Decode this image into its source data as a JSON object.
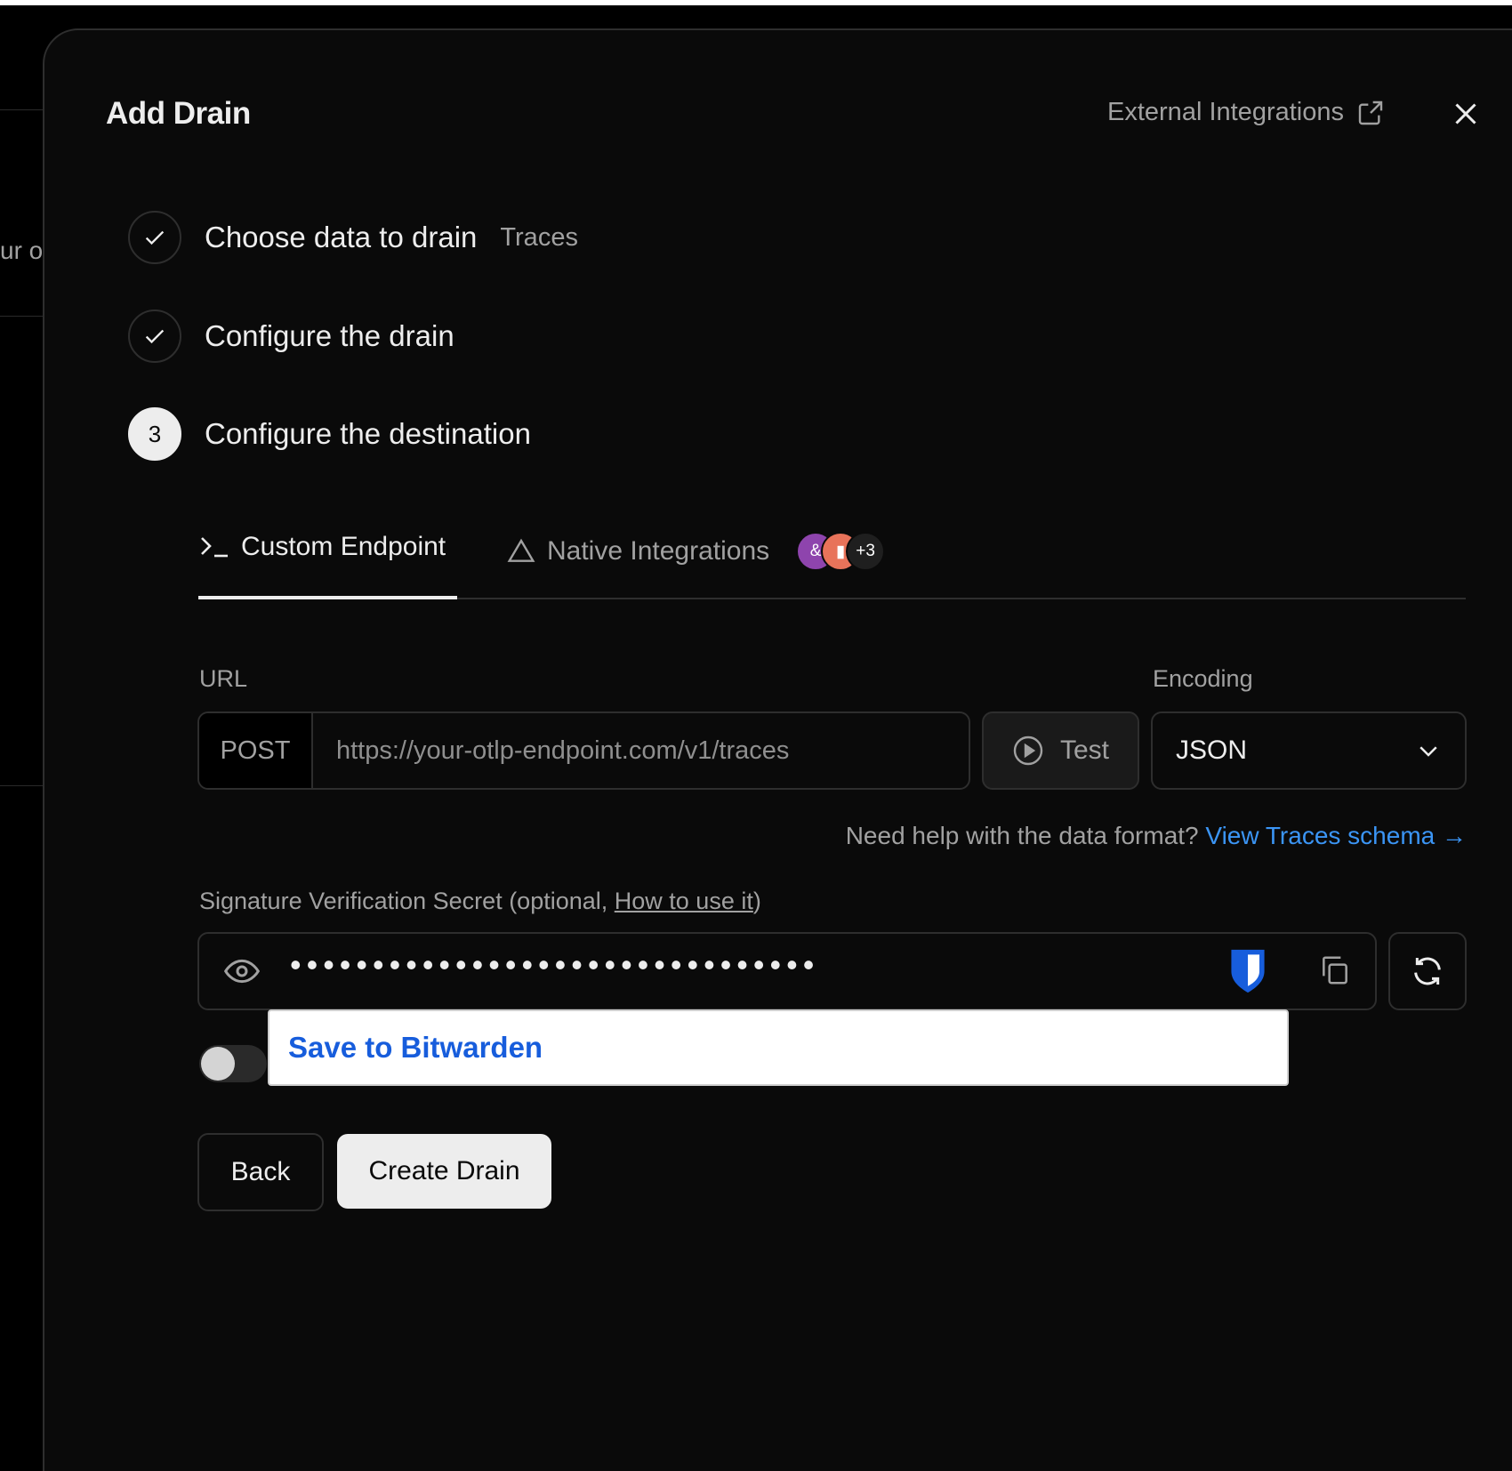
{
  "background": {
    "partial_text": "ur o"
  },
  "dialog": {
    "title": "Add Drain",
    "external_link_label": "External Integrations"
  },
  "steps": [
    {
      "label": "Choose data to drain",
      "value": "Traces",
      "state": "completed"
    },
    {
      "label": "Configure the drain",
      "value": "",
      "state": "completed"
    },
    {
      "label": "Configure the destination",
      "number": "3",
      "state": "active"
    }
  ],
  "tabs": {
    "custom": {
      "label": "Custom Endpoint",
      "icon": "terminal-icon",
      "active": true
    },
    "native": {
      "label": "Native Integrations",
      "icon": "triangle-icon",
      "extra_count": "+3",
      "active": false
    }
  },
  "form": {
    "url_label": "URL",
    "method": "POST",
    "url_value": "",
    "url_placeholder": "https://your-otlp-endpoint.com/v1/traces",
    "test_label": "Test",
    "encoding_label": "Encoding",
    "encoding_value": "JSON",
    "help_text": "Need help with the data format?",
    "help_link": "View Traces schema →",
    "secret_label_prefix": "Signature Verification Secret (optional, ",
    "secret_label_link": "How to use it",
    "secret_label_suffix": ")",
    "secret_masked": "••••••••••••••••••••••••••••••••",
    "toggle_on": false
  },
  "bitwarden": {
    "popup_label": "Save to Bitwarden"
  },
  "footer": {
    "back_label": "Back",
    "create_label": "Create Drain"
  },
  "colors": {
    "background": "#0a0a0a",
    "border": "#2e2e2e",
    "link": "#3b95f5",
    "bitwarden": "#175ddc",
    "avatar_1": "#8e44ad",
    "avatar_2": "#e8735a",
    "avatar_3": "#1f1f1f"
  }
}
